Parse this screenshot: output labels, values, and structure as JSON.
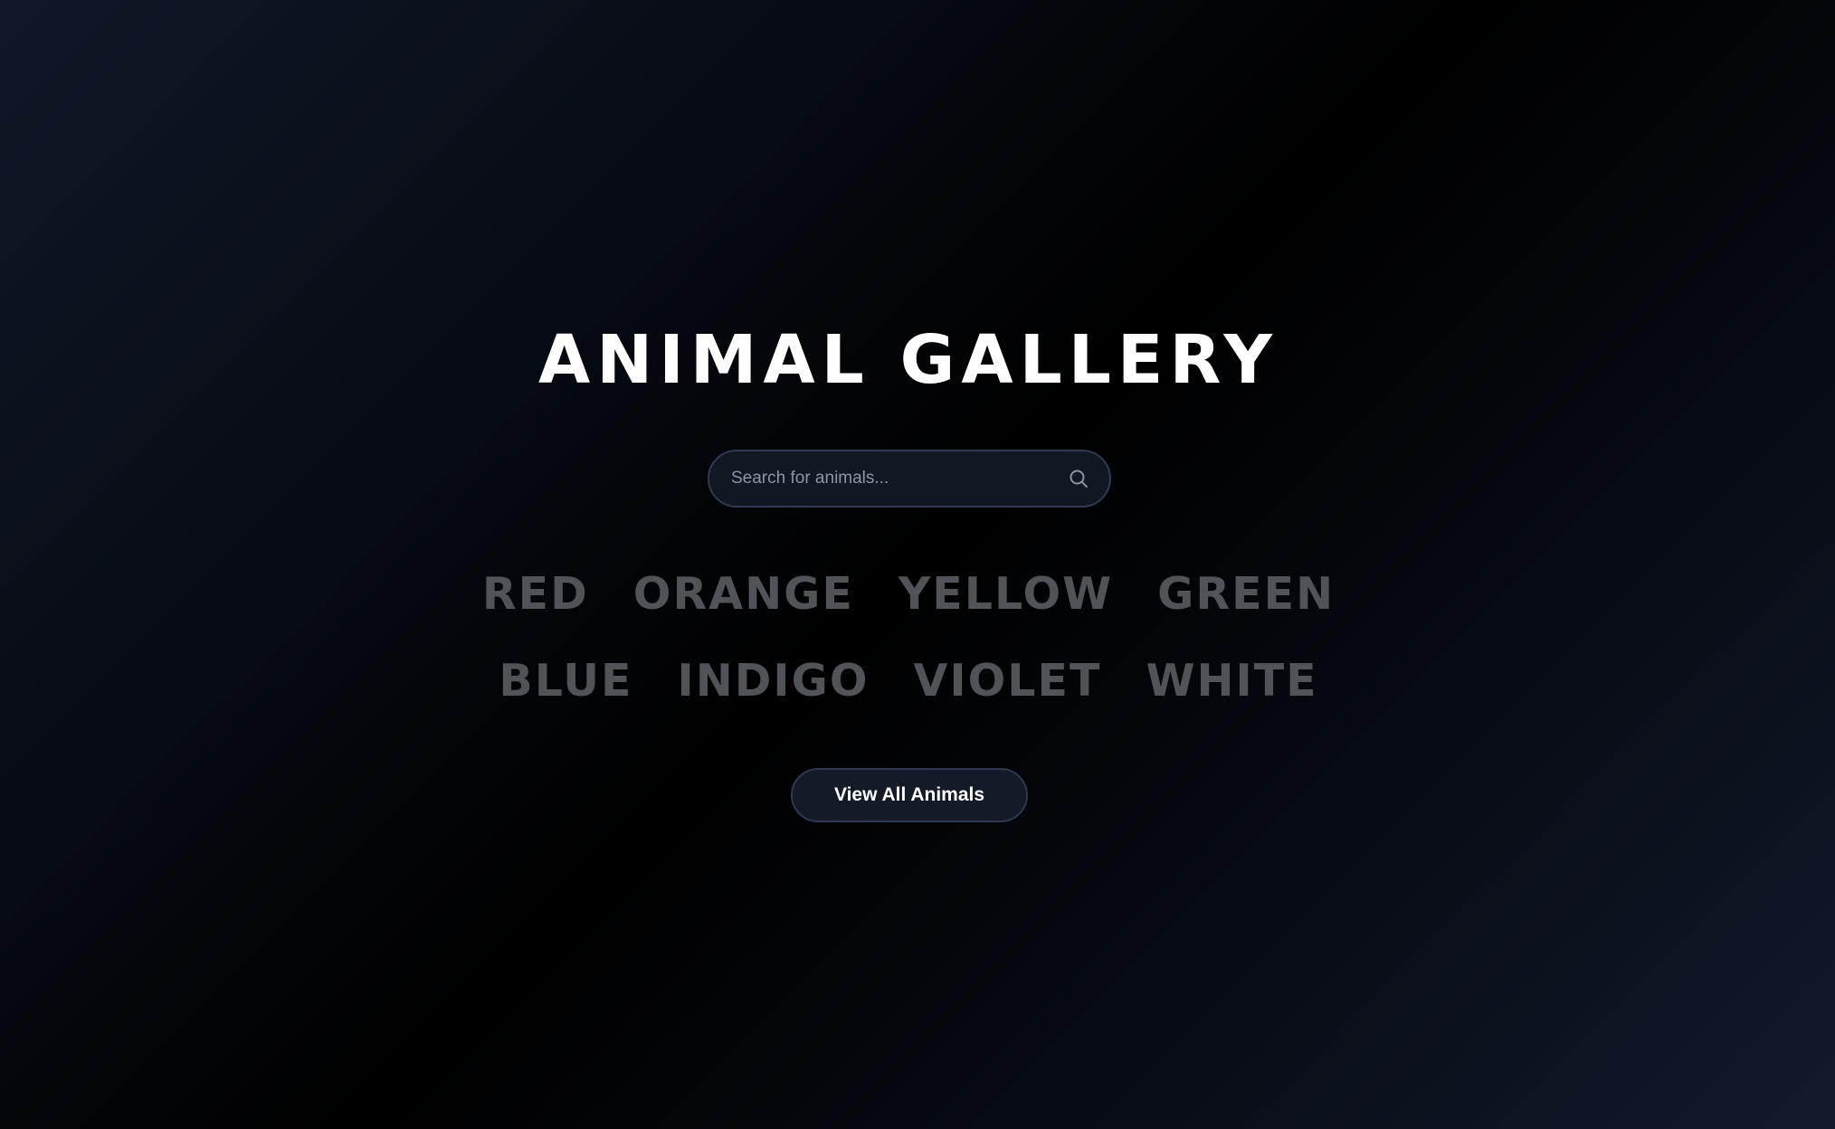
{
  "header": {
    "title": "ANIMAL GALLERY"
  },
  "search": {
    "placeholder": "Search for animals...",
    "value": "",
    "icon": "search-icon"
  },
  "color_filters": [
    {
      "label": "RED"
    },
    {
      "label": "ORANGE"
    },
    {
      "label": "YELLOW"
    },
    {
      "label": "GREEN"
    },
    {
      "label": "BLUE"
    },
    {
      "label": "INDIGO"
    },
    {
      "label": "VIOLET"
    },
    {
      "label": "WHITE"
    }
  ],
  "actions": {
    "view_all_label": "View All Animals"
  },
  "theme": {
    "text": "#ffffff",
    "muted_link": "#505357",
    "control_bg": "#121724",
    "control_border": "#2f3a52"
  }
}
